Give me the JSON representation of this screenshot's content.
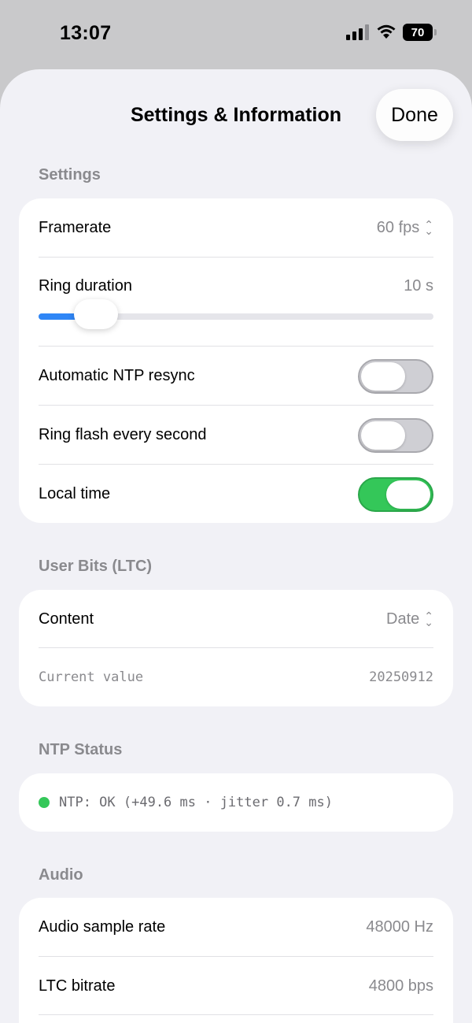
{
  "status_bar": {
    "time": "13:07",
    "battery": "70",
    "icons": [
      "cellular-signal-icon",
      "wifi-icon",
      "battery-icon"
    ]
  },
  "header": {
    "title": "Settings & Information",
    "done_label": "Done"
  },
  "settings": {
    "section_label": "Settings",
    "framerate": {
      "label": "Framerate",
      "value": "60 fps"
    },
    "ring_duration": {
      "label": "Ring duration",
      "value": "10 s",
      "slider_fraction": 0.1
    },
    "auto_ntp": {
      "label": "Automatic NTP resync",
      "on": false
    },
    "ring_flash": {
      "label": "Ring flash every second",
      "on": false
    },
    "local_time": {
      "label": "Local time",
      "on": true
    }
  },
  "user_bits": {
    "section_label": "User Bits (LTC)",
    "content": {
      "label": "Content",
      "value": "Date"
    },
    "current": {
      "label": "Current value",
      "value": "20250912"
    }
  },
  "ntp_status": {
    "section_label": "NTP Status",
    "text": "NTP: OK (+49.6 ms · jitter 0.7 ms)",
    "dot_color": "#34c759"
  },
  "audio": {
    "section_label": "Audio",
    "sample_rate": {
      "label": "Audio sample rate",
      "value": "48000 Hz"
    },
    "ltc_bitrate": {
      "label": "LTC bitrate",
      "value": "4800 bps"
    }
  },
  "colors": {
    "accent_blue": "#2f86f6",
    "toggle_on": "#34c759"
  }
}
